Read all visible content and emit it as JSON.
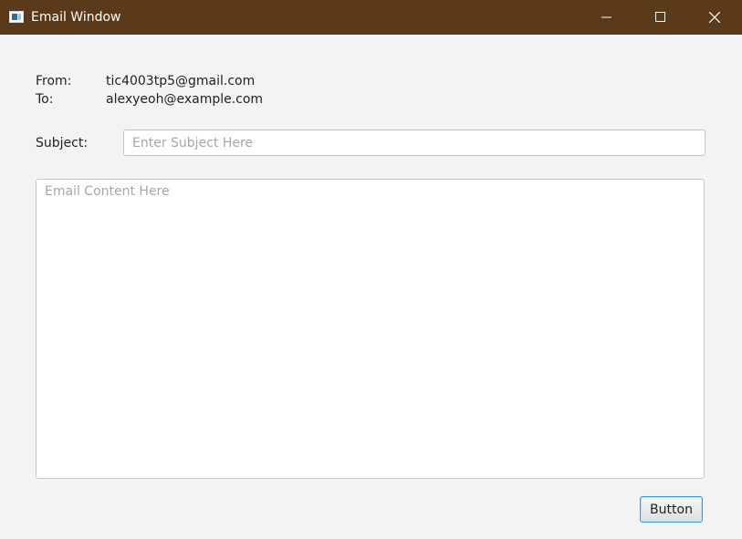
{
  "window": {
    "title": "Email Window",
    "titlebar_color": "#5b3a19"
  },
  "header": {
    "from_label": "From:",
    "from_value": "tic4003tp5@gmail.com",
    "to_label": "To:",
    "to_value": "alexyeoh@example.com"
  },
  "subject": {
    "label": "Subject:",
    "placeholder": "Enter Subject Here",
    "value": ""
  },
  "content": {
    "placeholder": "Email Content Here",
    "value": ""
  },
  "actions": {
    "button_label": "Button",
    "focus_color": "#3d9be0"
  },
  "icons": {
    "app": "window-app-icon",
    "minimize": "minimize-icon",
    "maximize": "maximize-icon",
    "close": "close-icon"
  }
}
